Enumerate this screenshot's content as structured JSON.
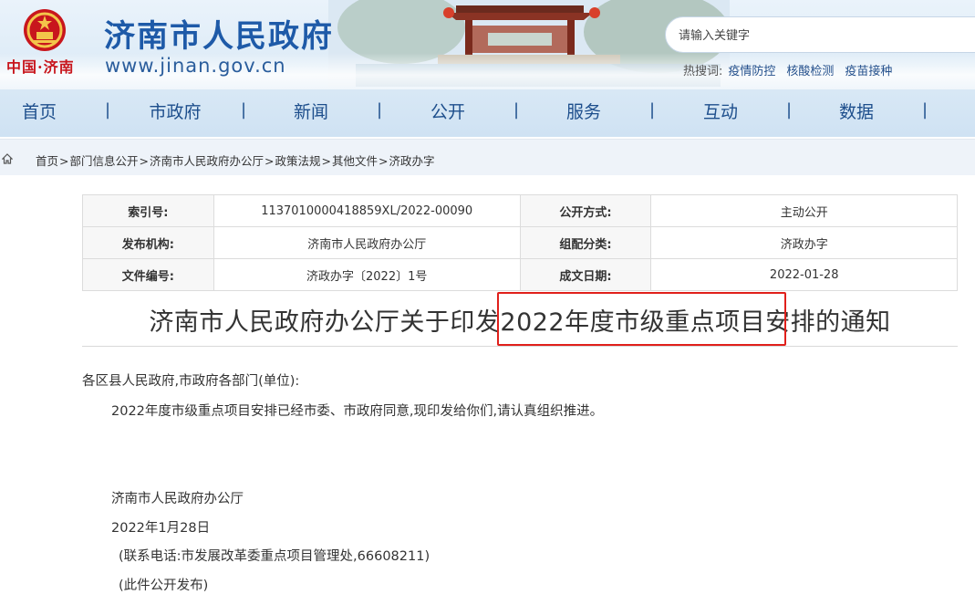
{
  "header": {
    "site_title": "济南市人民政府",
    "site_url": "www.jinan.gov.cn",
    "china_jinan": "中国·济南",
    "search": {
      "placeholder": "请输入关键字"
    },
    "hot_search": {
      "label": "热搜词:",
      "items": [
        "疫情防控",
        "核酸检测",
        "疫苗接种"
      ]
    }
  },
  "nav": {
    "items": [
      "首页",
      "市政府",
      "新闻",
      "公开",
      "服务",
      "互动",
      "数据"
    ],
    "separator": "|"
  },
  "breadcrumb": {
    "items": [
      "首页",
      "部门信息公开",
      "济南市人民政府办公厅",
      "政策法规",
      "其他文件",
      "济政办字"
    ],
    "separator": ">"
  },
  "meta": {
    "index_no_label": "索引号:",
    "index_no": "113701000041885 9XL/2022-00090",
    "disclosure_label": "公开方式:",
    "disclosure": "主动公开",
    "publisher_label": "发布机构:",
    "publisher": "济南市人民政府办公厅",
    "category_label": "组配分类:",
    "category": "济政办字",
    "doc_no_label": "文件编号:",
    "doc_no": "济政办字〔2022〕1号",
    "date_label": "成文日期:",
    "date": "2022-01-28"
  },
  "document": {
    "title": "济南市人民政府办公厅关于印发2022年度市级重点项目安排的通知",
    "salutation": "各区县人民政府,市政府各部门(单位):",
    "paragraph": "2022年度市级重点项目安排已经市委、市政府同意,现印发给你们,请认真组织推进。",
    "signer": "济南市人民政府办公厅",
    "sign_date": "2022年1月28日",
    "contact": "(联系电话:市发展改革委重点项目管理处,66608211)",
    "publish_note": "(此件公开发布)"
  },
  "colors": {
    "brand_blue": "#1e5aa8",
    "highlight_red": "#e0201b",
    "emblem_red": "#c8161d"
  }
}
